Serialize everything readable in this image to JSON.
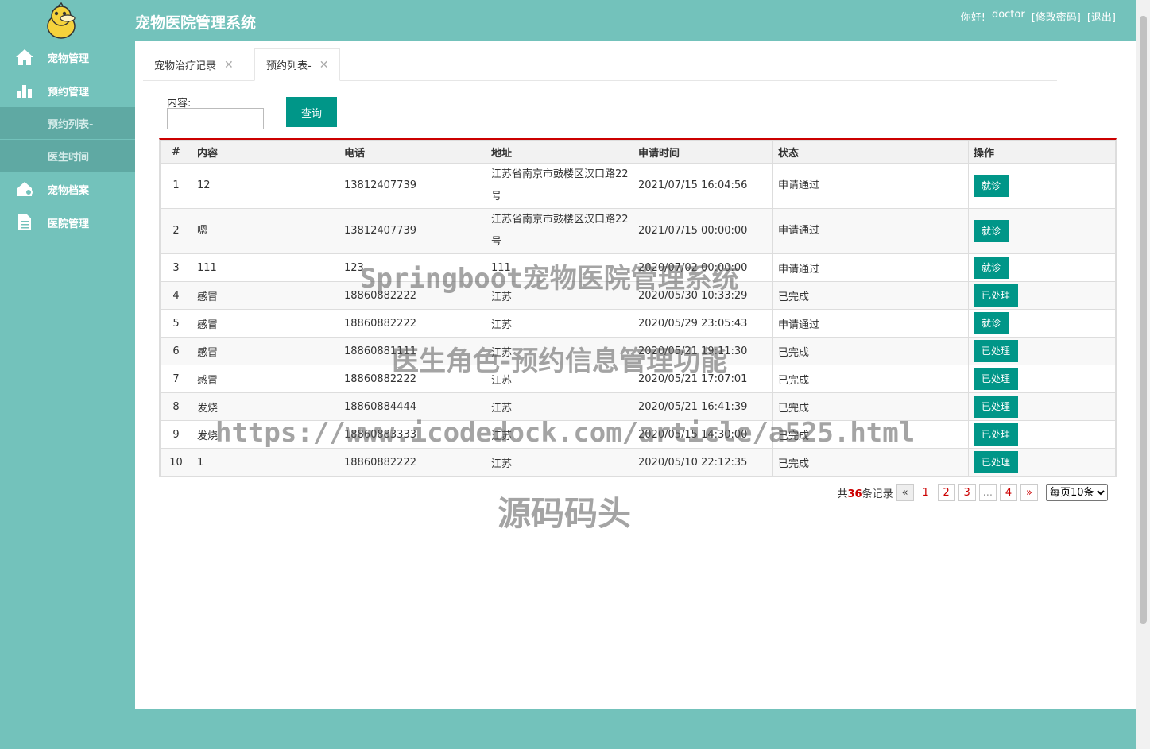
{
  "app": {
    "title": "宠物医院管理系统"
  },
  "header": {
    "greeting": "你好!",
    "username": "doctor",
    "change_password": "[修改密码]",
    "logout": "[退出]"
  },
  "sidebar": {
    "items": [
      {
        "label": "宠物管理",
        "icon": "home-icon"
      },
      {
        "label": "预约管理",
        "icon": "bar-chart-icon"
      },
      {
        "label": "宠物档案",
        "icon": "pet-file-icon"
      },
      {
        "label": "医院管理",
        "icon": "document-icon"
      }
    ],
    "subitems": [
      {
        "label": "预约列表-"
      },
      {
        "label": "医生时间"
      }
    ]
  },
  "tabs": [
    {
      "label": "宠物治疗记录"
    },
    {
      "label": "预约列表-"
    }
  ],
  "search": {
    "label": "内容:",
    "value": "",
    "button": "查询"
  },
  "table": {
    "headers": [
      "#",
      "内容",
      "电话",
      "地址",
      "申请时间",
      "状态",
      "操作"
    ],
    "rows": [
      {
        "n": "1",
        "content": "12",
        "phone": "13812407739",
        "address": "江苏省南京市鼓楼区汉口路22号",
        "time": "2021/07/15 16:04:56",
        "status": "申请通过",
        "action": "就诊"
      },
      {
        "n": "2",
        "content": "嗯",
        "phone": "13812407739",
        "address": "江苏省南京市鼓楼区汉口路22号",
        "time": "2021/07/15 00:00:00",
        "status": "申请通过",
        "action": "就诊"
      },
      {
        "n": "3",
        "content": "111",
        "phone": "123",
        "address": "111",
        "time": "2020/07/02 00:00:00",
        "status": "申请通过",
        "action": "就诊"
      },
      {
        "n": "4",
        "content": "感冒",
        "phone": "18860882222",
        "address": "江苏",
        "time": "2020/05/30 10:33:29",
        "status": "已完成",
        "action": "已处理"
      },
      {
        "n": "5",
        "content": "感冒",
        "phone": "18860882222",
        "address": "江苏",
        "time": "2020/05/29 23:05:43",
        "status": "申请通过",
        "action": "就诊"
      },
      {
        "n": "6",
        "content": "感冒",
        "phone": "18860881111",
        "address": "江苏",
        "time": "2020/05/21 19:11:30",
        "status": "已完成",
        "action": "已处理"
      },
      {
        "n": "7",
        "content": "感冒",
        "phone": "18860882222",
        "address": "江苏",
        "time": "2020/05/21 17:07:01",
        "status": "已完成",
        "action": "已处理"
      },
      {
        "n": "8",
        "content": "发烧",
        "phone": "18860884444",
        "address": "江苏",
        "time": "2020/05/21 16:41:39",
        "status": "已完成",
        "action": "已处理"
      },
      {
        "n": "9",
        "content": "发烧",
        "phone": "18860883333",
        "address": "江苏",
        "time": "2020/05/15 14:30:00",
        "status": "已完成",
        "action": "已处理"
      },
      {
        "n": "10",
        "content": "1",
        "phone": "18860882222",
        "address": "江苏",
        "time": "2020/05/10 22:12:35",
        "status": "已完成",
        "action": "已处理"
      }
    ]
  },
  "pagination": {
    "prefix": "共",
    "total": "36",
    "suffix": "条记录",
    "prev": "«",
    "pages": [
      "1",
      "2",
      "3",
      "...",
      "4"
    ],
    "next": "»",
    "per_page": "每页10条"
  },
  "watermark": {
    "line1": "Springboot宠物医院管理系统",
    "line2": "医生角色-预约信息管理功能",
    "line3": "https://www.icodedock.com/article/a525.html",
    "line4": "源码码头"
  }
}
